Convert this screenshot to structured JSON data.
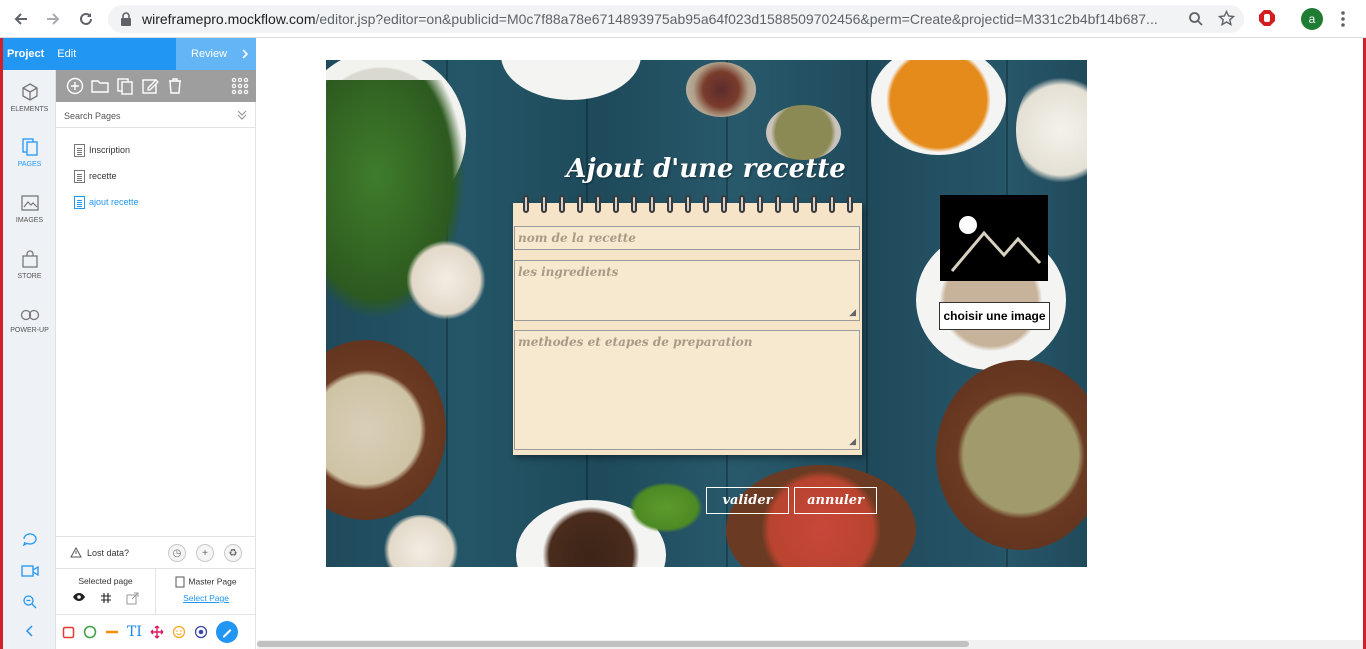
{
  "browser": {
    "url_host": "wireframepro.mockflow.com",
    "url_path": "/editor.jsp?editor=on&publicid=M0c7f88a78e6714893975ab95a64f023d1588509702456&perm=Create&projectid=M331c2b4bf14b687...",
    "avatar_letter": "a"
  },
  "topbar": {
    "project": "Project",
    "edit": "Edit",
    "review": "Review"
  },
  "rail": {
    "items": [
      {
        "label": "ELEMENTS"
      },
      {
        "label": "PAGES"
      },
      {
        "label": "IMAGES"
      },
      {
        "label": "STORE"
      },
      {
        "label": "POWER-UP"
      }
    ]
  },
  "panel": {
    "search_placeholder": "Search Pages",
    "pages": [
      {
        "label": "Inscription"
      },
      {
        "label": "recette"
      },
      {
        "label": "ajout recette"
      }
    ],
    "lost_data": "Lost data?",
    "selected_page": "Selected page",
    "master_page": "Master Page",
    "select_page": "Select Page"
  },
  "mockup": {
    "title": "Ajout d'une recette",
    "field_name": "nom de la recette",
    "field_ingredients": "les ingredients",
    "field_methods": "methodes et etapes de preparation",
    "choose_image": "choisir une image",
    "validate": "valider",
    "cancel": "annuler"
  },
  "colors": {
    "brand_blue": "#2196f3",
    "review_blue": "#64b5f6",
    "frame_red": "#d0202a",
    "toolbar_gray": "#9e9e9e"
  }
}
